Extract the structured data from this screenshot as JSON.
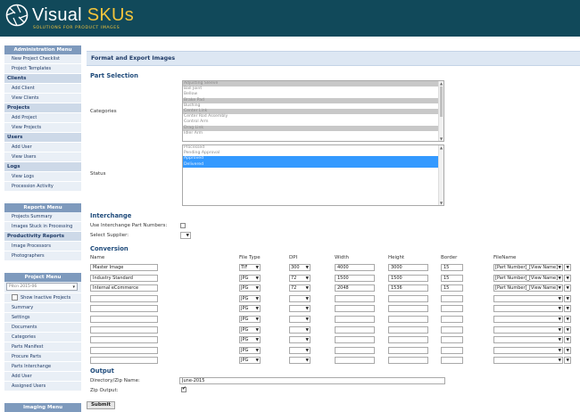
{
  "brand": {
    "name_a": "Visual ",
    "name_b": "SKUs",
    "tagline": "SOLUTIONS FOR PRODUCT IMAGES"
  },
  "colors": {
    "header": "#11495a",
    "accent": "#f3c43b",
    "menu_title": "#7e9abd",
    "link": "#1e3a66"
  },
  "sidebar": {
    "admin_title": "Administration Menu",
    "admin_top": [
      "New Project Checklist",
      "Project Templates"
    ],
    "sections": [
      {
        "title": "Clients",
        "items": [
          "Add Client",
          "View Clients"
        ]
      },
      {
        "title": "Projects",
        "items": [
          "Add Project",
          "View Projects"
        ]
      },
      {
        "title": "Users",
        "items": [
          "Add User",
          "View Users"
        ]
      },
      {
        "title": "Logs",
        "items": [
          "View Logs",
          "Procession Activity"
        ]
      }
    ],
    "reports_title": "Reports Menu",
    "reports_items": [
      "Projects Summary",
      "Images Stuck in Processing"
    ],
    "productivity_title": "Productivity Reports",
    "productivity_items": [
      "Image Processors",
      "Photographers"
    ],
    "project_title": "Project Menu",
    "project_select_value": "Pitcn 2015-06",
    "show_inactive": "Show Inactive Projects",
    "project_items": [
      "Summary",
      "Settings",
      "Documents",
      "Categories",
      "Parts Manifest",
      "Procure Parts",
      "Parts Interchange",
      "Add User",
      "Assigned Users"
    ],
    "imaging_title": "Imaging Menu"
  },
  "main": {
    "title": "Format and Export Images",
    "part_selection": "Part Selection",
    "categories_label": "Categories",
    "categories": [
      "Adjusting Sleeve",
      "Ball Joint",
      "Bellow",
      "Brake Pad",
      "Bushing",
      "Center Link",
      "Center Rod Assembly",
      "Control Arm",
      "Drag Link",
      "Idler Arm"
    ],
    "categories_selected": [
      0,
      3,
      5,
      8
    ],
    "status_label": "Status",
    "statuses": [
      "Processed",
      "Pending Approval",
      "Approved",
      "Delivered"
    ],
    "statuses_selected": [
      2,
      3
    ],
    "interchange": "Interchange",
    "use_interchange": "Use Interchange Part Numbers:",
    "select_supplier": "Select Supplier:",
    "conversion": "Conversion",
    "headers": {
      "name": "Name",
      "file_type": "File Type",
      "dpi": "DPI",
      "width": "Width",
      "height": "Height",
      "border": "Border",
      "filename": "FileName"
    },
    "rows": [
      {
        "name": "Master Image",
        "file_type": "TIF",
        "dpi": "300",
        "width": "4000",
        "height": "3000",
        "border": "15",
        "filename": "[Part Number]_[View Name]"
      },
      {
        "name": "Industry Standard",
        "file_type": "JPG",
        "dpi": "72",
        "width": "1500",
        "height": "1500",
        "border": "15",
        "filename": "[Part Number]_[View Name]"
      },
      {
        "name": "Internal eCommerce",
        "file_type": "JPG",
        "dpi": "72",
        "width": "2048",
        "height": "1536",
        "border": "15",
        "filename": "[Part Number]_[View Name]"
      },
      {
        "name": "",
        "file_type": "JPG",
        "dpi": "",
        "width": "",
        "height": "",
        "border": "",
        "filename": ""
      },
      {
        "name": "",
        "file_type": "JPG",
        "dpi": "",
        "width": "",
        "height": "",
        "border": "",
        "filename": ""
      },
      {
        "name": "",
        "file_type": "JPG",
        "dpi": "",
        "width": "",
        "height": "",
        "border": "",
        "filename": ""
      },
      {
        "name": "",
        "file_type": "JPG",
        "dpi": "",
        "width": "",
        "height": "",
        "border": "",
        "filename": ""
      },
      {
        "name": "",
        "file_type": "JPG",
        "dpi": "",
        "width": "",
        "height": "",
        "border": "",
        "filename": ""
      },
      {
        "name": "",
        "file_type": "JPG",
        "dpi": "",
        "width": "",
        "height": "",
        "border": "",
        "filename": ""
      },
      {
        "name": "",
        "file_type": "JPG",
        "dpi": "",
        "width": "",
        "height": "",
        "border": "",
        "filename": ""
      }
    ],
    "output": "Output",
    "dir_label": "Directory/Zip Name:",
    "dir_value": "June-2015",
    "zip_label": "Zip Output:",
    "submit": "Submit"
  }
}
